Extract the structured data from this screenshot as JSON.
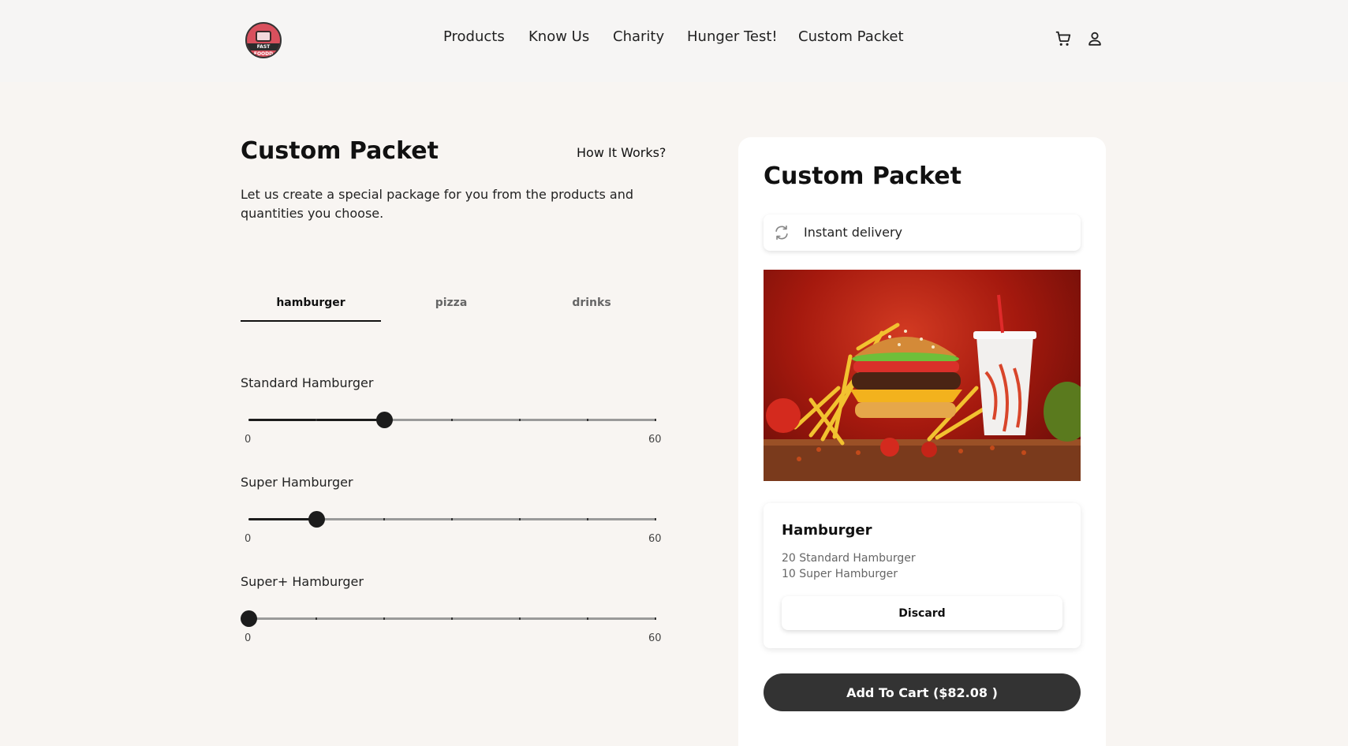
{
  "header": {
    "logo_text": "FAST FOODD",
    "nav": [
      "Products",
      "Know Us",
      "Charity",
      "Hunger Test!",
      "Custom Packet"
    ],
    "cart_icon": "cart-icon",
    "user_icon": "user-icon"
  },
  "builder": {
    "title": "Custom Packet",
    "how_link": "How It Works?",
    "description": "Let us create a special package for you from the products and quantities you choose.",
    "tabs": [
      "hamburger",
      "pizza",
      "drinks"
    ],
    "active_tab": "hamburger",
    "sliders": [
      {
        "label": "Standard Hamburger",
        "min": "0",
        "max": "60",
        "value": 20
      },
      {
        "label": "Super Hamburger",
        "min": "0",
        "max": "60",
        "value": 10
      },
      {
        "label": "Super+ Hamburger",
        "min": "0",
        "max": "60",
        "value": 0
      }
    ]
  },
  "panel": {
    "title": "Custom Packet",
    "delivery_icon": "refresh-icon",
    "delivery_text": "Instant delivery",
    "image_alt": "hamburger-meal-image",
    "summary_title": "Hamburger",
    "summary_lines": [
      "20 Standard Hamburger",
      "10 Super Hamburger"
    ],
    "discard_label": "Discard",
    "add_to_cart_label": "Add To Cart ($82.08 )"
  },
  "colors": {
    "background": "#f8f5f2",
    "header_bg": "#f6f5f4",
    "accent_dark": "#333333",
    "slider_fill": "#1c1c1c",
    "logo_red": "#d9505d"
  }
}
